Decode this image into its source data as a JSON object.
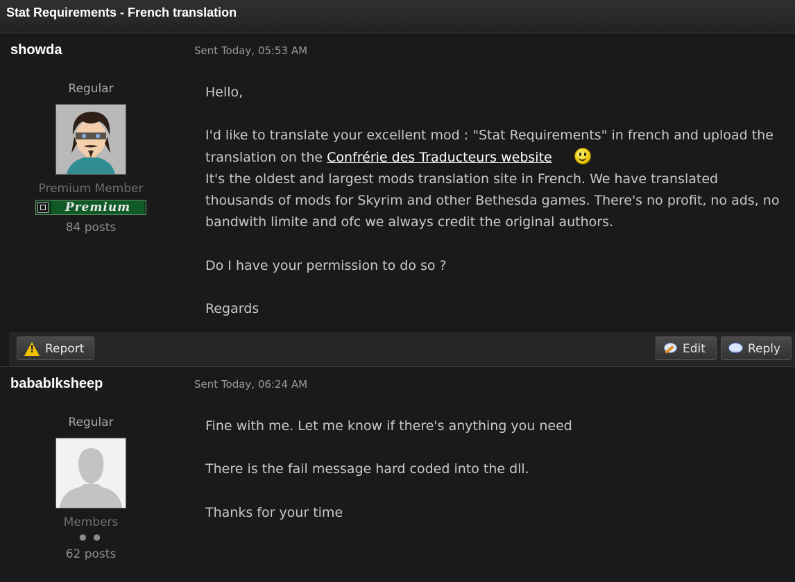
{
  "window": {
    "title": "Stat Requirements - French translation"
  },
  "posts": [
    {
      "author": "showda",
      "sent": "Sent Today, 05:53 AM",
      "rank": "Regular",
      "avatar": "avatar-cartoon-icon",
      "group": "Premium Member",
      "badge": "Premium",
      "post_count": "84 posts",
      "body": {
        "p1": "Hello,",
        "p2_before_link": "I'd like to translate your excellent mod : \"Stat Requirements\" in french and upload the translation on the ",
        "link": "Confrérie des Traducteurs website",
        "smiley": "smiley-icon",
        "p2_after": "It's the oldest and largest mods translation site in French. We have translated thousands of mods for Skyrim and other Bethesda games. There's no profit, no ads, no bandwith limite and ofc we always credit the original authors.",
        "p3": "Do I have your permission to do so ?",
        "p4": "Regards"
      },
      "actions": {
        "report": "Report",
        "edit": "Edit",
        "reply": "Reply"
      }
    },
    {
      "author": "bababIksheep",
      "sent": "Sent Today, 06:24 AM",
      "rank": "Regular",
      "avatar": "default-avatar-icon",
      "group": "Members",
      "pips": "● ●",
      "post_count": "62 posts",
      "body": {
        "p1": "Fine with me. Let me know if there's anything you need",
        "p2": "There is the fail message hard coded into the dll.",
        "p3": "Thanks for your time"
      }
    }
  ],
  "colors": {
    "background": "#141414",
    "post_background": "#1a1a1a",
    "link": "#ffffff",
    "badge_green": "#0f5a26"
  }
}
